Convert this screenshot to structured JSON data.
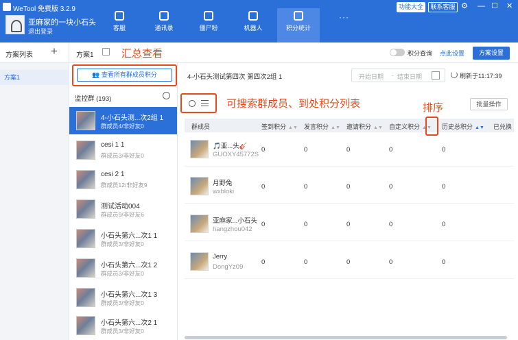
{
  "app": {
    "title": "WeTool 免费版 3.2.9",
    "feature_btn": "功能大全",
    "service_btn": "联系客服",
    "settings_icon": "gear-icon"
  },
  "user": {
    "name": "亚麻家的一块小石头",
    "logout": "退出登录"
  },
  "nav": [
    {
      "label": "客服",
      "icon": "service-icon",
      "active": false
    },
    {
      "label": "通讯录",
      "icon": "contacts-icon",
      "active": false
    },
    {
      "label": "僵尸粉",
      "icon": "zombie-icon",
      "active": false
    },
    {
      "label": "机器人",
      "icon": "robot-icon",
      "active": false
    },
    {
      "label": "积分统计",
      "icon": "database-icon",
      "active": true
    }
  ],
  "nav_more": "···",
  "schemes": {
    "title": "方案列表",
    "add": "+",
    "items": [
      "方案1"
    ]
  },
  "main": {
    "scheme_name": "方案1",
    "view_all_btn": "查看所有群成员积分",
    "points_toggle_label": "积分查询",
    "points_setting_link": "点此设置",
    "scheme_settings_btn": "方案设置"
  },
  "annotations": {
    "summary": "汇总查看",
    "search_hint": "可搜索群成员、到处积分列表",
    "sort_hint": "排序"
  },
  "monitor": {
    "title": "监控群 (193)"
  },
  "groups": [
    {
      "name": "4-小石头测...次2组  1",
      "sub": "群成员4/非好友0",
      "active": true
    },
    {
      "name": "cesi  1  1",
      "sub": "群成员3/非好友0",
      "active": false
    },
    {
      "name": "cesi  2  1",
      "sub": "群成员12/非好友9",
      "active": false
    },
    {
      "name": "测试活动004",
      "sub": "群成员9/非好友6",
      "active": false
    },
    {
      "name": "小石头第六...次1  1",
      "sub": "群成员3/非好友0",
      "active": false
    },
    {
      "name": "小石头第六...次1  2",
      "sub": "群成员3/非好友0",
      "active": false
    },
    {
      "name": "小石头第六...次1  3",
      "sub": "群成员3/非好友0",
      "active": false
    },
    {
      "name": "小石头第六...次2  1",
      "sub": "群成员3/非好友0",
      "active": false
    }
  ],
  "right": {
    "group_info": "4-小石头测试第四次  第四次2组  1",
    "date_start": "开始日期",
    "date_sep": "-",
    "date_end": "结束日期",
    "refresh": "刷新于11:17:39",
    "batch_btn": "批量操作"
  },
  "table": {
    "headers": [
      "群成员",
      "签到积分",
      "发言积分",
      "邀请积分",
      "自定义积分",
      "历史总积分",
      "已兑换"
    ],
    "rows": [
      {
        "name": "🎵亚...头🎸",
        "id": "GUOXY45772S",
        "values": [
          "0",
          "0",
          "0",
          "0",
          "0"
        ]
      },
      {
        "name": "月野兔",
        "id": "wxbloki",
        "values": [
          "0",
          "0",
          "0",
          "0",
          "0"
        ]
      },
      {
        "name": "亚麻家...小石头",
        "id": "hangzhou042",
        "values": [
          "0",
          "0",
          "0",
          "0",
          "0"
        ]
      },
      {
        "name": "Jerry",
        "id": "DongYz09",
        "values": [
          "0",
          "0",
          "0",
          "0",
          "0"
        ]
      }
    ]
  }
}
